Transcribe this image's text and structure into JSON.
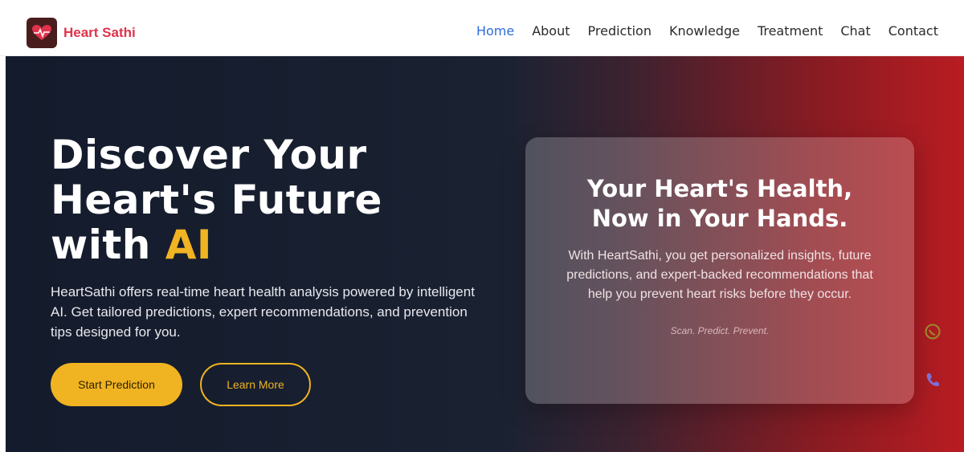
{
  "brand": {
    "name": "Heart Sathi"
  },
  "nav": {
    "items": [
      {
        "label": "Home"
      },
      {
        "label": "About"
      },
      {
        "label": "Prediction"
      },
      {
        "label": "Knowledge"
      },
      {
        "label": "Treatment"
      },
      {
        "label": "Chat"
      },
      {
        "label": "Contact"
      }
    ],
    "active": "Home"
  },
  "hero": {
    "title_line1": "Discover Your",
    "title_line2": "Heart's Future",
    "title_line3_prefix": "with ",
    "title_highlight": "AI",
    "description": "HeartSathi offers real-time heart health analysis powered by intelligent AI. Get tailored predictions, expert recommendations, and prevention tips designed for you.",
    "primary_button": "Start Prediction",
    "secondary_button": "Learn More"
  },
  "card": {
    "title_line1": "Your Heart's Health,",
    "title_line2": "Now in Your Hands.",
    "description": "With HeartSathi, you get personalized insights, future predictions, and expert-backed recommendations that help you prevent heart risks before they occur.",
    "tagline": "Scan. Predict. Prevent."
  },
  "icons": {
    "logo": "heart-pulse-icon",
    "floating": [
      "chat-icon",
      "phone-icon"
    ]
  },
  "colors": {
    "brand": "#e0334c",
    "accent": "#f0b322",
    "nav_active": "#2f6bd8",
    "hero_dark": "#141b2c",
    "hero_red": "#b81c22"
  }
}
